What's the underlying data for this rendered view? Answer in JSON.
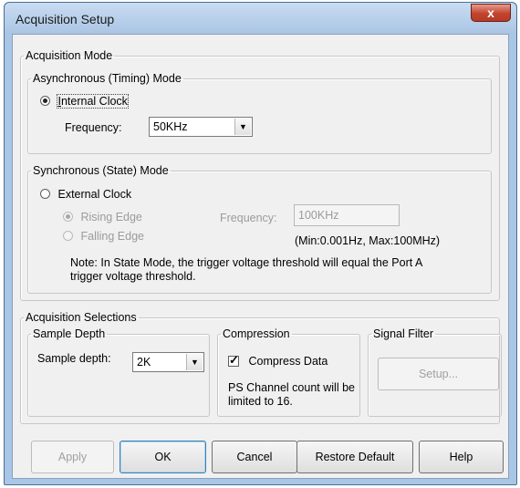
{
  "window": {
    "title": "Acquisition Setup",
    "close_symbol": "x"
  },
  "acquisition_mode": {
    "legend": "Acquisition Mode",
    "asynchronous": {
      "legend": "Asynchronous (Timing) Mode",
      "internal_clock_accel": "I",
      "internal_clock_rest": "nternal Clock",
      "internal_clock_selected": true,
      "frequency_label": "Frequency:",
      "frequency_value": "50KHz"
    },
    "synchronous": {
      "legend": "Synchronous (State) Mode",
      "external_clock_label": "External Clock",
      "external_clock_selected": false,
      "rising_edge_label": "Rising Edge",
      "falling_edge_label": "Falling Edge",
      "frequency_label": "Frequency:",
      "frequency_value": "100KHz",
      "frequency_range": "(Min:0.001Hz, Max:100MHz)",
      "note_line1": "Note: In State Mode, the trigger voltage threshold will equal the Port A",
      "note_line2": "trigger voltage threshold."
    }
  },
  "acquisition_selections": {
    "legend": "Acquisition Selections",
    "sample_depth": {
      "legend": "Sample Depth",
      "label": "Sample depth:",
      "value": "2K"
    },
    "compression": {
      "legend": "Compression",
      "checkbox_label": "Compress Data",
      "checked": true,
      "note_line1": "PS Channel count will be",
      "note_line2": "limited to 16."
    },
    "signal_filter": {
      "legend": "Signal Filter",
      "setup_label": "Setup..."
    }
  },
  "buttons": {
    "apply": "Apply",
    "ok": "OK",
    "cancel": "Cancel",
    "restore_default": "Restore Default",
    "help": "Help"
  },
  "icons": {
    "close": "close-icon",
    "dropdown": "chevron-down-icon",
    "check": "checkmark-icon"
  }
}
